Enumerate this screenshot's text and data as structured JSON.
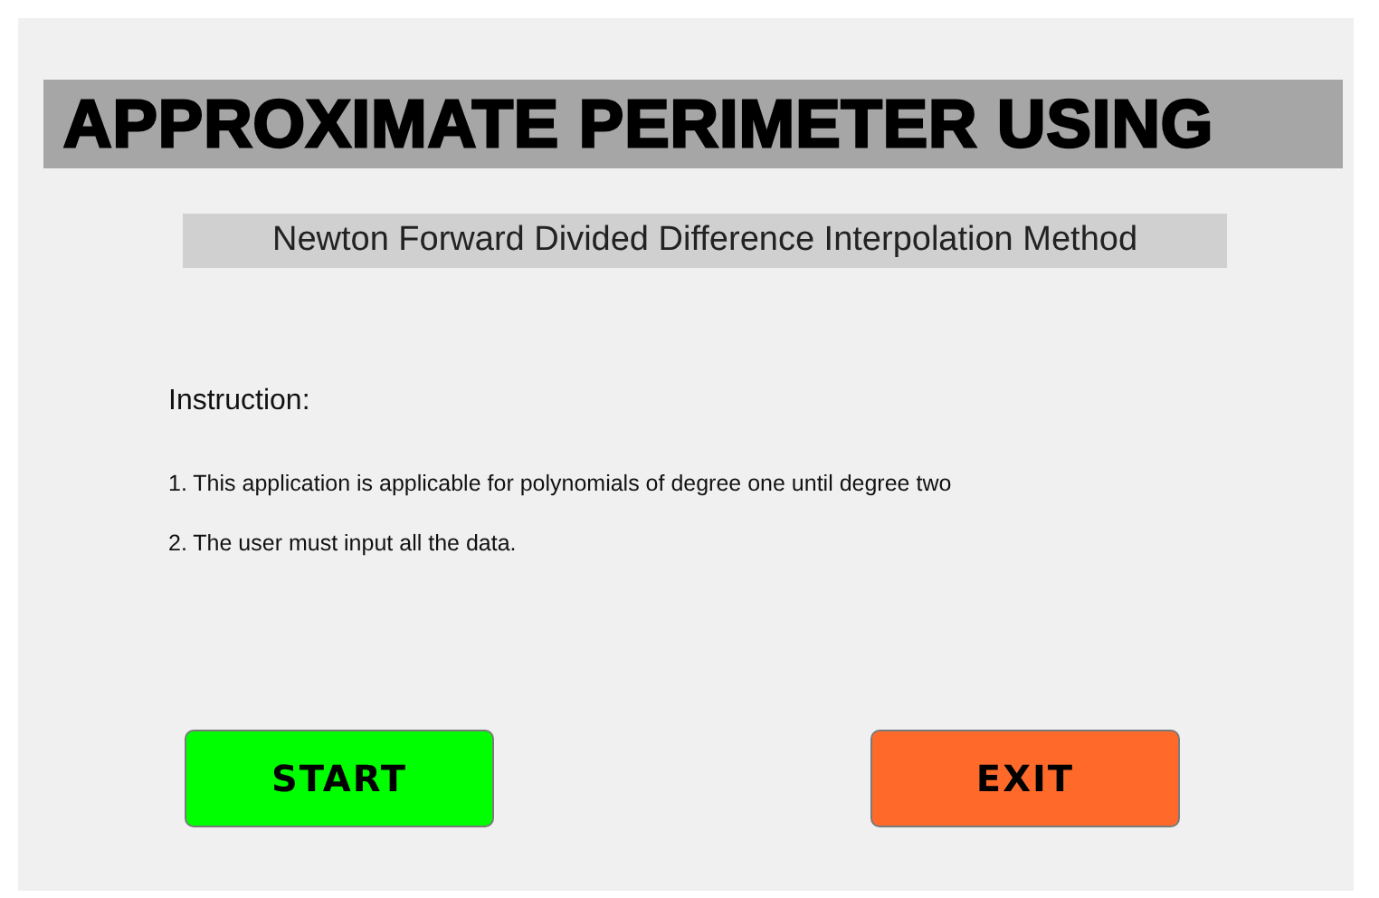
{
  "title": "APPROXIMATE PERIMETER USING",
  "subtitle": "Newton Forward Divided Difference Interpolation Method",
  "instruction": {
    "heading": "Instruction:",
    "lines": [
      "1. This application is applicable for polynomials of degree one until degree two",
      "2. The user must input all the data."
    ]
  },
  "buttons": [
    {
      "label": "START",
      "color": "#00ff00"
    },
    {
      "label": "EXIT",
      "color": "#ff6a2b"
    }
  ]
}
